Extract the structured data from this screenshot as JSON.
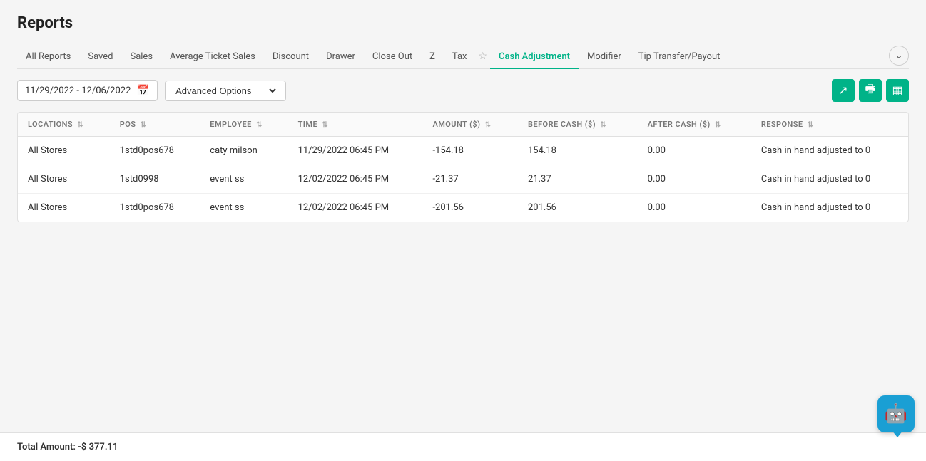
{
  "page": {
    "title": "Reports"
  },
  "nav": {
    "tabs": [
      {
        "id": "all-reports",
        "label": "All Reports",
        "active": false
      },
      {
        "id": "saved",
        "label": "Saved",
        "active": false
      },
      {
        "id": "sales",
        "label": "Sales",
        "active": false
      },
      {
        "id": "average-ticket-sales",
        "label": "Average Ticket Sales",
        "active": false
      },
      {
        "id": "discount",
        "label": "Discount",
        "active": false
      },
      {
        "id": "drawer",
        "label": "Drawer",
        "active": false
      },
      {
        "id": "close-out",
        "label": "Close Out",
        "active": false
      },
      {
        "id": "z",
        "label": "Z",
        "active": false
      },
      {
        "id": "tax",
        "label": "Tax",
        "active": false
      },
      {
        "id": "cash-adjustment",
        "label": "Cash Adjustment",
        "active": true
      },
      {
        "id": "modifier",
        "label": "Modifier",
        "active": false
      },
      {
        "id": "tip-transfer-payout",
        "label": "Tip Transfer/Payout",
        "active": false
      }
    ]
  },
  "toolbar": {
    "date_range": "11/29/2022 - 12/06/2022",
    "advanced_options_label": "Advanced Options",
    "advanced_options_placeholder": "Advanced Options",
    "export_label": "Export",
    "print_label": "Print",
    "columns_label": "Columns"
  },
  "table": {
    "columns": [
      {
        "id": "locations",
        "label": "LOCATIONS"
      },
      {
        "id": "pos",
        "label": "POS"
      },
      {
        "id": "employee",
        "label": "EMPLOYEE"
      },
      {
        "id": "time",
        "label": "TIME"
      },
      {
        "id": "amount",
        "label": "AMOUNT ($)"
      },
      {
        "id": "before_cash",
        "label": "BEFORE CASH ($)"
      },
      {
        "id": "after_cash",
        "label": "AFTER CASH ($)"
      },
      {
        "id": "response",
        "label": "RESPONSE"
      }
    ],
    "rows": [
      {
        "locations": "All Stores",
        "pos": "1std0pos678",
        "employee": "caty milson",
        "time": "11/29/2022 06:45 PM",
        "amount": "-154.18",
        "before_cash": "154.18",
        "after_cash": "0.00",
        "response": "Cash in hand adjusted to 0"
      },
      {
        "locations": "All Stores",
        "pos": "1std0998",
        "employee": "event ss",
        "time": "12/02/2022 06:45 PM",
        "amount": "-21.37",
        "before_cash": "21.37",
        "after_cash": "0.00",
        "response": "Cash in hand adjusted to 0"
      },
      {
        "locations": "All Stores",
        "pos": "1std0pos678",
        "employee": "event ss",
        "time": "12/02/2022 06:45 PM",
        "amount": "-201.56",
        "before_cash": "201.56",
        "after_cash": "0.00",
        "response": "Cash in hand adjusted to 0"
      }
    ]
  },
  "footer": {
    "total_label": "Total Amount: -$ 377.11"
  },
  "colors": {
    "active_tab": "#00b388",
    "toolbar_btn": "#00b388",
    "chatbot_bg": "#1a9fd4"
  }
}
